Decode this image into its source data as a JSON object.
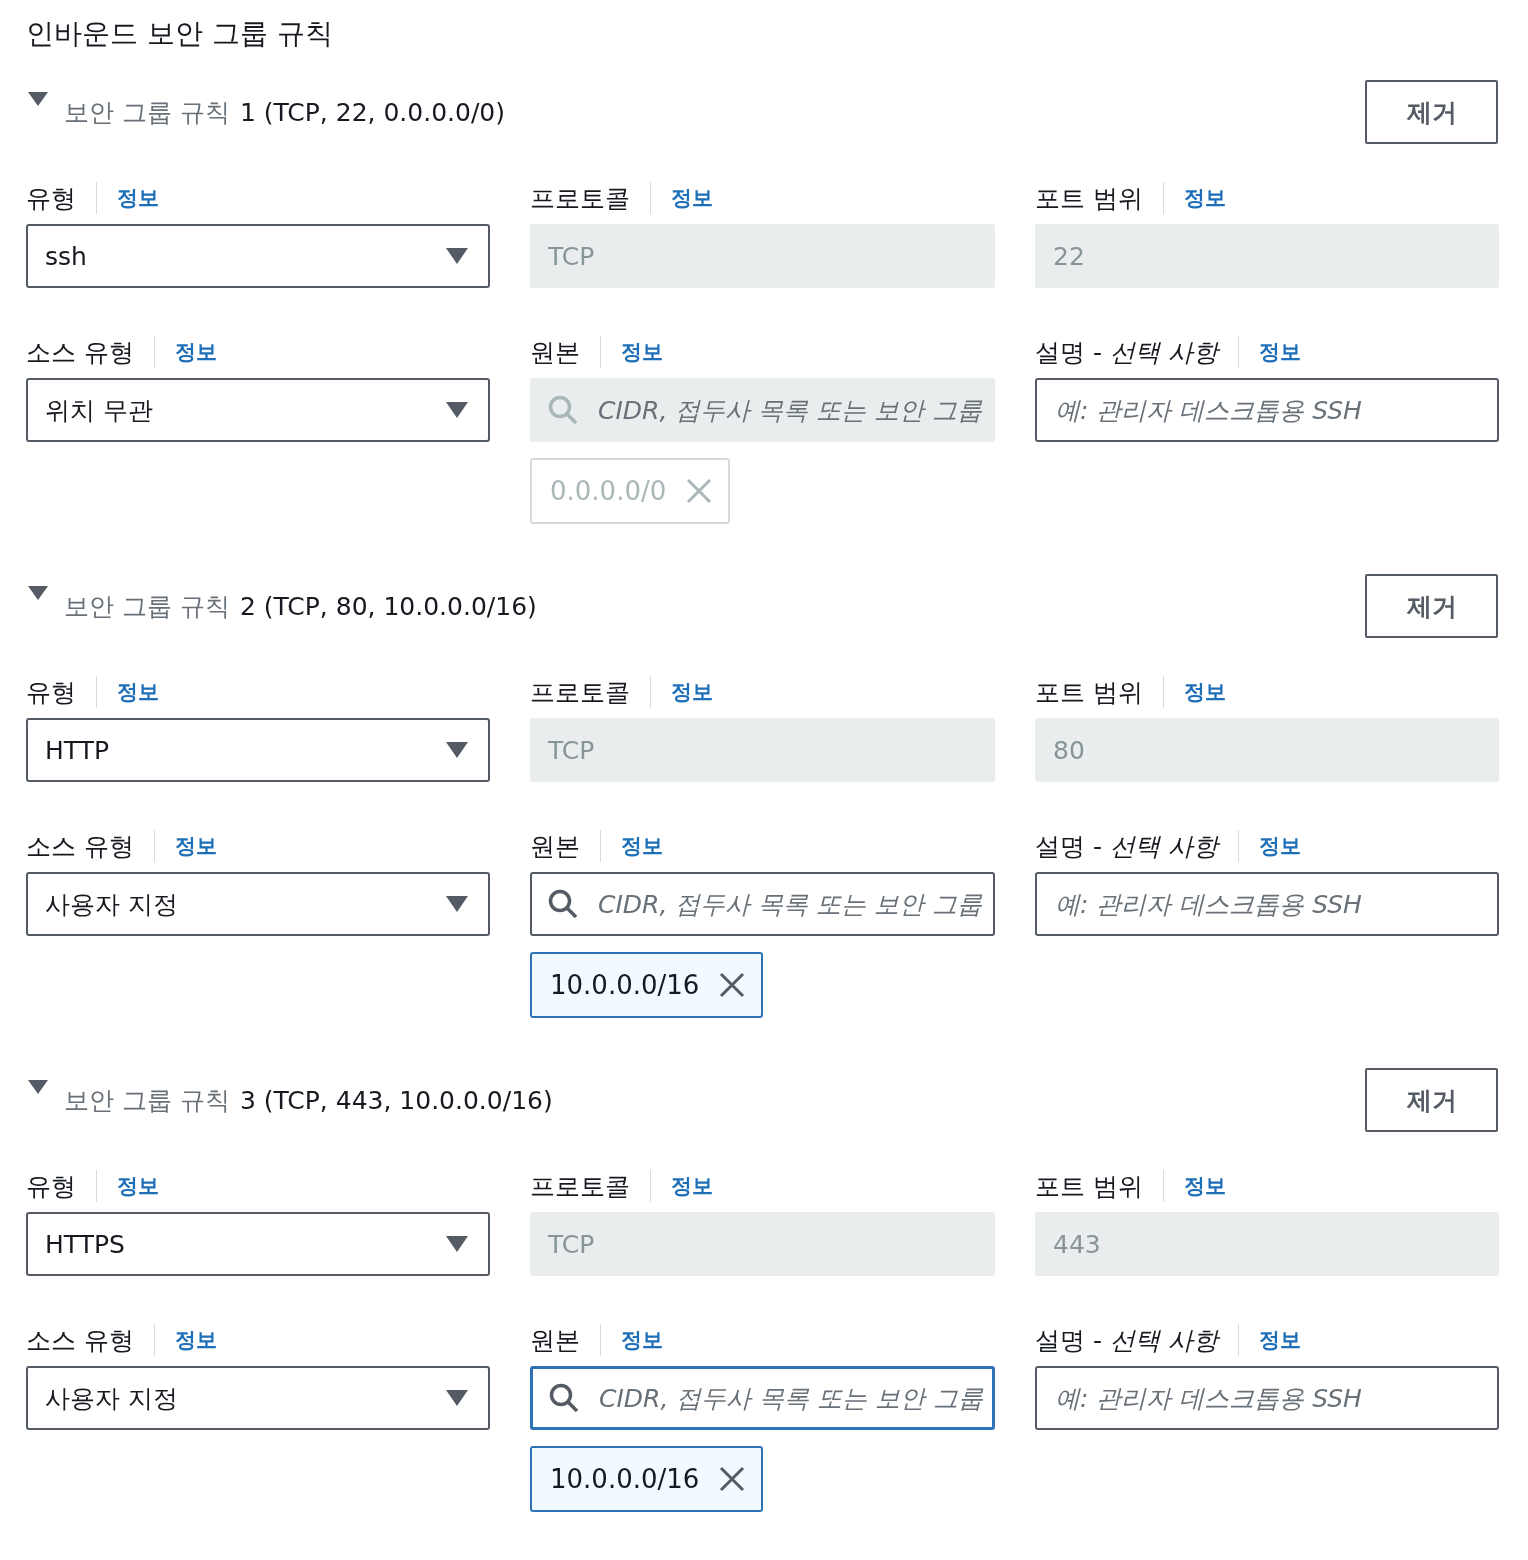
{
  "title": "인바운드 보안 그룹 규칙",
  "rules": [
    {
      "expanded": true,
      "label": "보안 그룹 규칙",
      "summary": "1 (TCP, 22, 0.0.0.0/0)",
      "remove_button": "제거",
      "fields": [
        {
          "kind": "select",
          "label": "유형",
          "info": "정보",
          "value": "ssh"
        },
        {
          "kind": "readonly",
          "label": "프로토콜",
          "info": "정보",
          "value": "TCP"
        },
        {
          "kind": "readonly",
          "label": "포트 범위",
          "info": "정보",
          "value": "22"
        },
        {
          "kind": "select",
          "label": "소스 유형",
          "info": "정보",
          "value": "위치 무관"
        },
        {
          "kind": "search",
          "label": "원본",
          "info": "정보",
          "placeholder": "CIDR, 접두사 목록 또는 보안 그룹",
          "disabled": true,
          "focused": false,
          "tokens": [
            {
              "text": "0.0.0.0/0",
              "disabled": true
            }
          ]
        },
        {
          "kind": "text",
          "label": "설명 - *선택 사항*",
          "info": "정보",
          "placeholder": "예: 관리자 데스크톱용 SSH"
        }
      ]
    },
    {
      "expanded": true,
      "label": "보안 그룹 규칙",
      "summary": "2 (TCP, 80, 10.0.0.0/16)",
      "remove_button": "제거",
      "fields": [
        {
          "kind": "select",
          "label": "유형",
          "info": "정보",
          "value": "HTTP"
        },
        {
          "kind": "readonly",
          "label": "프로토콜",
          "info": "정보",
          "value": "TCP"
        },
        {
          "kind": "readonly",
          "label": "포트 범위",
          "info": "정보",
          "value": "80"
        },
        {
          "kind": "select",
          "label": "소스 유형",
          "info": "정보",
          "value": "사용자 지정"
        },
        {
          "kind": "search",
          "label": "원본",
          "info": "정보",
          "placeholder": "CIDR, 접두사 목록 또는 보안 그룹",
          "disabled": false,
          "focused": false,
          "tokens": [
            {
              "text": "10.0.0.0/16",
              "disabled": false
            }
          ]
        },
        {
          "kind": "text",
          "label": "설명 - *선택 사항*",
          "info": "정보",
          "placeholder": "예: 관리자 데스크톱용 SSH"
        }
      ]
    },
    {
      "expanded": true,
      "label": "보안 그룹 규칙",
      "summary": "3 (TCP, 443, 10.0.0.0/16)",
      "remove_button": "제거",
      "fields": [
        {
          "kind": "select",
          "label": "유형",
          "info": "정보",
          "value": "HTTPS"
        },
        {
          "kind": "readonly",
          "label": "프로토콜",
          "info": "정보",
          "value": "TCP"
        },
        {
          "kind": "readonly",
          "label": "포트 범위",
          "info": "정보",
          "value": "443"
        },
        {
          "kind": "select",
          "label": "소스 유형",
          "info": "정보",
          "value": "사용자 지정"
        },
        {
          "kind": "search",
          "label": "원본",
          "info": "정보",
          "placeholder": "CIDR, 접두사 목록 또는 보안 그룹",
          "disabled": false,
          "focused": true,
          "tokens": [
            {
              "text": "10.0.0.0/16",
              "disabled": false
            }
          ]
        },
        {
          "kind": "text",
          "label": "설명 - *선택 사항*",
          "info": "정보",
          "placeholder": "예: 관리자 데스크톱용 SSH"
        }
      ]
    }
  ]
}
